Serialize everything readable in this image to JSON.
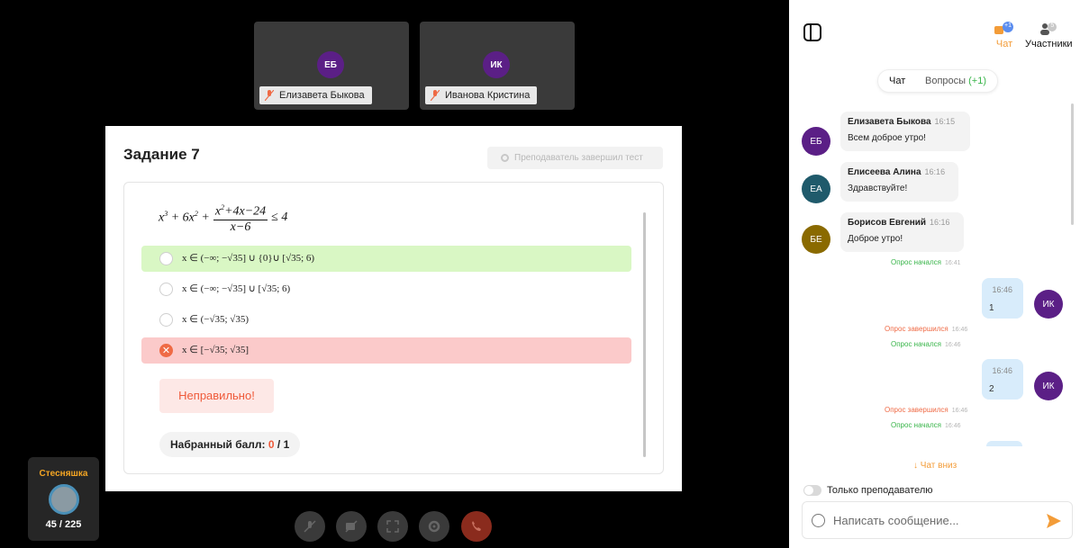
{
  "participants": [
    {
      "initials": "ЕБ",
      "name": "Елизавета Быкова"
    },
    {
      "initials": "ИК",
      "name": "Иванова Кристина"
    }
  ],
  "task": {
    "title": "Задание 7",
    "status": "Преподаватель завершил тест",
    "options": [
      {
        "text": "x ∈ (−∞; −√35] ∪ {0}∪ [√35; 6)",
        "state": "correct"
      },
      {
        "text": "x ∈ (−∞; −√35] ∪ [√35; 6)",
        "state": "none"
      },
      {
        "text": "x ∈ (−√35; √35)",
        "state": "none"
      },
      {
        "text": "x ∈ [−√35; √35]",
        "state": "wrong-selected"
      }
    ],
    "result_label": "Неправильно!",
    "score_label": "Набранный балл:",
    "score_value": "0",
    "score_sep": "/",
    "score_max": "1"
  },
  "badge": {
    "title": "Стесняшка",
    "progress": "45 / 225"
  },
  "controls": [
    "mic-off-icon",
    "video-off-icon",
    "fullscreen-icon",
    "settings-icon",
    "end-call-icon"
  ],
  "panel": {
    "nav_chat": "Чат",
    "nav_chat_badge": "+1",
    "nav_participants": "Участники",
    "nav_participants_badge": "5",
    "seg_chat": "Чат",
    "seg_questions": "Вопросы",
    "seg_questions_count": "(+1)",
    "messages": [
      {
        "initials": "ЕБ",
        "name": "Елизавета Быкова",
        "time": "16:15",
        "text": "Всем доброе утро!",
        "color": "#5b1f86"
      },
      {
        "initials": "ЕА",
        "name": "Елисеева Алина",
        "time": "16:16",
        "text": "Здравствуйте!",
        "color": "#1f5a6b"
      },
      {
        "initials": "БЕ",
        "name": "Борисов Евгений",
        "time": "16:16",
        "text": "Доброе утро!",
        "color": "#8a6a00"
      }
    ],
    "sys1": {
      "text": "Опрос начался",
      "time": "16:41"
    },
    "my1": {
      "time": "16:46",
      "text": "1",
      "initials": "ИК"
    },
    "sys2": {
      "text": "Опрос завершился",
      "time": "16:46"
    },
    "sys3": {
      "text": "Опрос начался",
      "time": "16:46"
    },
    "my2": {
      "time": "16:46",
      "text": "2",
      "initials": "ИК"
    },
    "sys4": {
      "text": "Опрос завершился",
      "time": "16:46"
    },
    "sys5": {
      "text": "Опрос начался",
      "time": "16:46"
    },
    "chat_down": "↓ Чат вниз",
    "only_teacher": "Только преподавателю",
    "input_placeholder": "Написать сообщение..."
  }
}
